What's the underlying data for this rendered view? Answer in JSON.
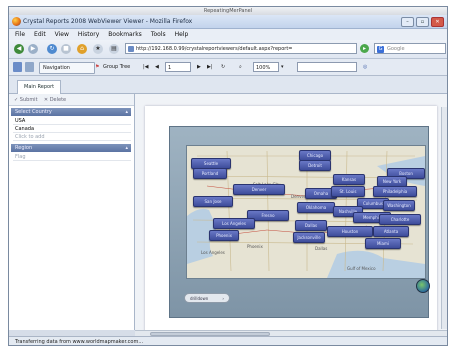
{
  "os_title": "RepeatingMerPanel",
  "browser": {
    "title": "Crystal Reports 2008 WebViewer Viewer - Mozilla Firefox",
    "menu": [
      "File",
      "Edit",
      "View",
      "History",
      "Bookmarks",
      "Tools",
      "Help"
    ],
    "url": "http://192.168.0.99/crystalreportviewers/default.aspx?report=",
    "search_placeholder": "Google"
  },
  "viewer_toolbar": {
    "navigation_label": "Navigation",
    "group_tree_label": "Group Tree",
    "page_value": "1",
    "zoom_value": "100%"
  },
  "tab": {
    "label": "Main Report"
  },
  "panel": {
    "tools": [
      "Submit",
      "Delete"
    ],
    "sections": [
      {
        "title": "Select Country",
        "rows": [
          "USA",
          "Canada"
        ],
        "hint": "Click to add"
      },
      {
        "title": "Region",
        "rows": [],
        "hint": "Flag"
      }
    ]
  },
  "map": {
    "place_labels": [
      "Salt Lake City",
      "Denver",
      "Los Angeles",
      "Phoenix",
      "Dallas",
      "Gulf of Mexico"
    ],
    "pins": [
      {
        "label": "Seattle"
      },
      {
        "label": "Chicago"
      },
      {
        "label": "Boston"
      },
      {
        "label": "Portland"
      },
      {
        "label": "Denver"
      },
      {
        "label": "Detroit"
      },
      {
        "label": "New York"
      },
      {
        "label": "Kansas"
      },
      {
        "label": "Omaha"
      },
      {
        "label": "Philadelphia"
      },
      {
        "label": "San Jose"
      },
      {
        "label": "St. Louis"
      },
      {
        "label": "Columbus"
      },
      {
        "label": "Washington"
      },
      {
        "label": "Fresno"
      },
      {
        "label": "Oklahoma"
      },
      {
        "label": "Nashville"
      },
      {
        "label": "Los Angeles"
      },
      {
        "label": "Memphis"
      },
      {
        "label": "Charlotte"
      },
      {
        "label": "Phoenix"
      },
      {
        "label": "Dallas"
      },
      {
        "label": "Atlanta"
      },
      {
        "label": "Houston"
      },
      {
        "label": "Jacksonville"
      },
      {
        "label": "Miami"
      }
    ],
    "control_label": "drilldown"
  },
  "status": {
    "text": "Transferring data from www.worldmapmaker.com..."
  }
}
